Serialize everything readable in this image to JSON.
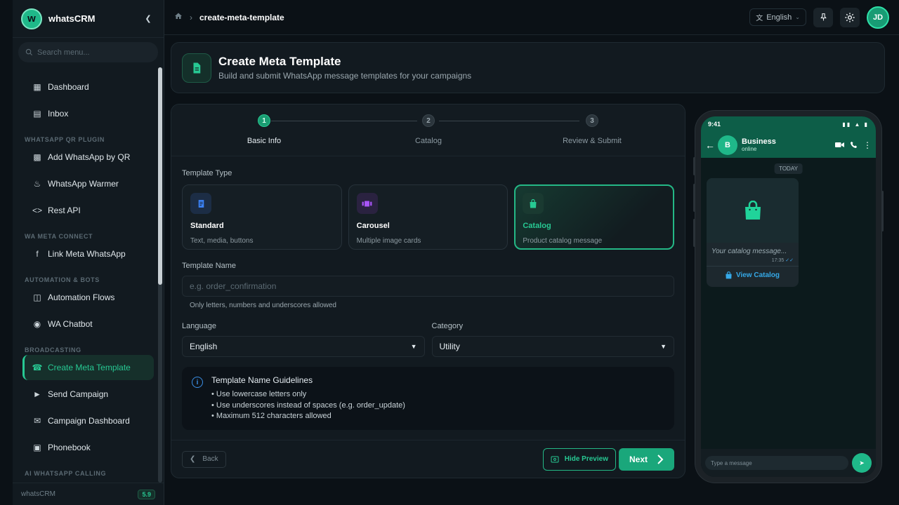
{
  "brand": {
    "name": "whatsCRM",
    "logo_letter": "w"
  },
  "sidebar": {
    "search_placeholder": "Search menu...",
    "items": [
      {
        "type": "item",
        "label": "Dashboard",
        "icon": "dashboard-icon"
      },
      {
        "type": "item",
        "label": "Inbox",
        "icon": "inbox-icon"
      },
      {
        "type": "section",
        "label": "WHATSAPP QR PLUGIN"
      },
      {
        "type": "item",
        "label": "Add WhatsApp by QR",
        "icon": "qr-icon"
      },
      {
        "type": "item",
        "label": "WhatsApp Warmer",
        "icon": "flame-icon"
      },
      {
        "type": "item",
        "label": "Rest API",
        "icon": "code-icon"
      },
      {
        "type": "section",
        "label": "WA META CONNECT"
      },
      {
        "type": "item",
        "label": "Link Meta WhatsApp",
        "icon": "facebook-icon"
      },
      {
        "type": "section",
        "label": "AUTOMATION & BOTS"
      },
      {
        "type": "item",
        "label": "Automation Flows",
        "icon": "flow-icon"
      },
      {
        "type": "item",
        "label": "WA Chatbot",
        "icon": "robot-icon"
      },
      {
        "type": "section",
        "label": "BROADCASTING"
      },
      {
        "type": "item",
        "label": "Create Meta Template",
        "icon": "whatsapp-icon",
        "active": true
      },
      {
        "type": "item",
        "label": "Send Campaign",
        "icon": "megaphone-icon"
      },
      {
        "type": "item",
        "label": "Campaign Dashboard",
        "icon": "mail-chart-icon"
      },
      {
        "type": "item",
        "label": "Phonebook",
        "icon": "contact-card-icon"
      },
      {
        "type": "section",
        "label": "AI WHATSAPP CALLING"
      }
    ],
    "footer_name": "whatsCRM",
    "version": "5.9"
  },
  "topbar": {
    "breadcrumb": "create-meta-template",
    "language": "English",
    "avatar_initials": "JD"
  },
  "header": {
    "title": "Create Meta Template",
    "subtitle": "Build and submit WhatsApp message templates for your campaigns"
  },
  "stepper": [
    {
      "number": "1",
      "label": "Basic Info",
      "active": true
    },
    {
      "number": "2",
      "label": "Catalog",
      "active": false
    },
    {
      "number": "3",
      "label": "Review & Submit",
      "active": false
    }
  ],
  "form": {
    "template_type_label": "Template Type",
    "types": [
      {
        "name": "Standard",
        "desc": "Text, media, buttons",
        "icon": "document-icon",
        "color": "#3b82f6",
        "bg": "#1c2d45"
      },
      {
        "name": "Carousel",
        "desc": "Multiple image cards",
        "icon": "carousel-icon",
        "color": "#a855f7",
        "bg": "#2a2240"
      },
      {
        "name": "Catalog",
        "desc": "Product catalog message",
        "icon": "shopping-bag-icon",
        "color": "#27c993",
        "bg": "#1a3a31",
        "selected": true
      }
    ],
    "template_name_label": "Template Name",
    "template_name_placeholder": "e.g. order_confirmation",
    "template_name_value": "",
    "template_name_hint": "Only letters, numbers and underscores allowed",
    "language_label": "Language",
    "language_value": "English",
    "category_label": "Category",
    "category_value": "Utility",
    "guidelines": {
      "title": "Template Name Guidelines",
      "items": [
        "Use lowercase letters only",
        "Use underscores instead of spaces (e.g. order_update)",
        "Maximum 512 characters allowed"
      ]
    },
    "back_label": "Back",
    "hide_preview_label": "Hide Preview",
    "next_label": "Next"
  },
  "preview": {
    "time": "9:41",
    "contact_name": "Business",
    "contact_initial": "B",
    "contact_status": "online",
    "date_chip": "TODAY",
    "message_text": "Your catalog message...",
    "message_time": "17:35",
    "button_label": "View Catalog",
    "input_placeholder": "Type a message"
  },
  "colors": {
    "accent": "#27c993",
    "info": "#3b8fe6",
    "link": "#35a9e8"
  }
}
